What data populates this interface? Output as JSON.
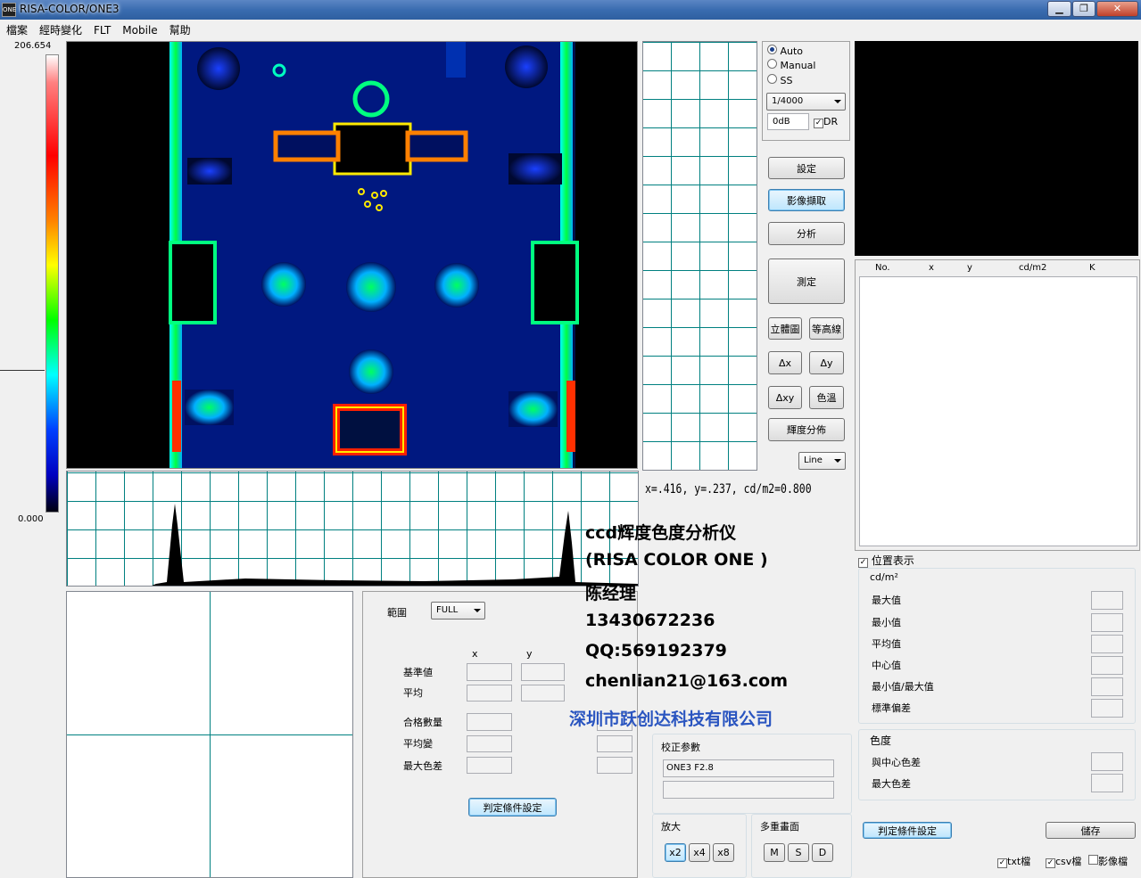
{
  "window": {
    "title": "RISA-COLOR/ONE3",
    "app_icon": "ONE",
    "min_icon": "minimize-icon",
    "max_icon": "maximize-icon",
    "close_icon": "close-icon"
  },
  "menu": [
    "檔案",
    "經時變化",
    "FLT",
    "Mobile",
    "幫助"
  ],
  "scale": {
    "max": "206.654",
    "min": "0.000",
    "level": 0.312
  },
  "exposure": {
    "modes": [
      {
        "label": "Auto",
        "selected": true
      },
      {
        "label": "Manual",
        "selected": false
      },
      {
        "label": "SS",
        "selected": false
      }
    ],
    "shutter": "1/4000",
    "gain": "0dB",
    "dr_label": "DR",
    "dr_checked": true
  },
  "buttons": {
    "settings": "設定",
    "capture": "影像擷取",
    "analyze": "分析",
    "measure": "測定",
    "stereo": "立體圖",
    "contour": "等高線",
    "dx": "Δx",
    "dy": "Δy",
    "dxy": "Δxy",
    "color_temp": "色溫",
    "lum_dist": "輝度分佈"
  },
  "line_mode": "Line",
  "readout": "x=.416, y=.237, cd/m2=0.800",
  "table": {
    "headers": [
      "No.",
      "x",
      "y",
      "cd/m2",
      "K"
    ],
    "rows": []
  },
  "position_display": {
    "label": "位置表示",
    "checked": true
  },
  "stats": {
    "unit": "cd/m²",
    "items": [
      "最大值",
      "最小值",
      "平均值",
      "中心值",
      "最小值/最大值",
      "標準偏差"
    ],
    "color_title": "色度",
    "color_items": [
      "與中心色差",
      "最大色差"
    ]
  },
  "judge": {
    "range_label": "範圍",
    "range_value": "FULL",
    "col_x": "x",
    "col_y": "y",
    "rows": [
      "基準値",
      "平均"
    ],
    "rows2": [
      "合格數量",
      "平均變",
      "最大色差"
    ],
    "button": "判定條件設定"
  },
  "calib": {
    "title": "校正参數",
    "value": "ONE3 F2.8"
  },
  "zoom": {
    "title": "放大",
    "buttons": [
      "x2",
      "x4",
      "x8"
    ],
    "selected": "x2"
  },
  "multi": {
    "title": "多重畫面",
    "buttons": [
      "M",
      "S",
      "D"
    ]
  },
  "right_bottom": {
    "judge_button": "判定條件設定",
    "save_button": "儲存",
    "checks": [
      {
        "label": "txt檔",
        "checked": true
      },
      {
        "label": "csv檔",
        "checked": true
      },
      {
        "label": "影像檔",
        "checked": false
      }
    ]
  },
  "watermark": {
    "line1": "ccd辉度色度分析仪",
    "line2": "(RISA COLOR ONE   )",
    "line3": "陈经理",
    "line4": "13430672236",
    "line5": "QQ:569192379",
    "line6": "chenlian21@163.com",
    "company": "深圳市跃创达科技有限公司"
  },
  "colors": {
    "accent": "#3c7fb1",
    "company": "#2a55c0"
  }
}
